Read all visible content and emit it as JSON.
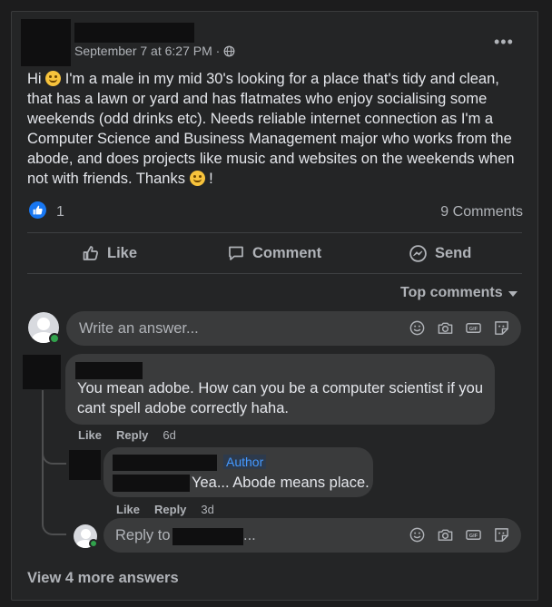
{
  "post": {
    "timestamp": "September 7 at 6:27 PM ·",
    "privacy_icon": "globe-icon",
    "body_part1": "Hi ",
    "body_part2": " I'm a male in my mid 30's looking for a place that's tidy and clean, that has a lawn or yard and has flatmates who enjoy socialising some weekends (odd drinks etc). Needs reliable internet connection as I'm a Computer Science and Business Management major who works from the abode, and does projects like music and websites on the weekends when not with friends. Thanks ",
    "body_part3": "!",
    "reaction_count": "1",
    "comment_count": "9 Comments"
  },
  "actions": {
    "like": "Like",
    "comment": "Comment",
    "send": "Send"
  },
  "sort": {
    "label": "Top comments"
  },
  "composer": {
    "placeholder": "Write an answer..."
  },
  "comments": [
    {
      "text": "You mean adobe. How can you be a computer scientist if you cant spell adobe correctly haha.",
      "like": "Like",
      "reply": "Reply",
      "time": "6d"
    },
    {
      "author_tag": "Author",
      "text": "Yea... Abode means place.",
      "like": "Like",
      "reply": "Reply",
      "time": "3d"
    }
  ],
  "reply_box": {
    "prefix": "Reply to",
    "suffix": "..."
  },
  "view_more": "View 4 more answers",
  "colors": {
    "background": "#242526",
    "accent": "#1877f2",
    "bubble": "#3a3b3c",
    "author_tag": "#4599ff"
  }
}
